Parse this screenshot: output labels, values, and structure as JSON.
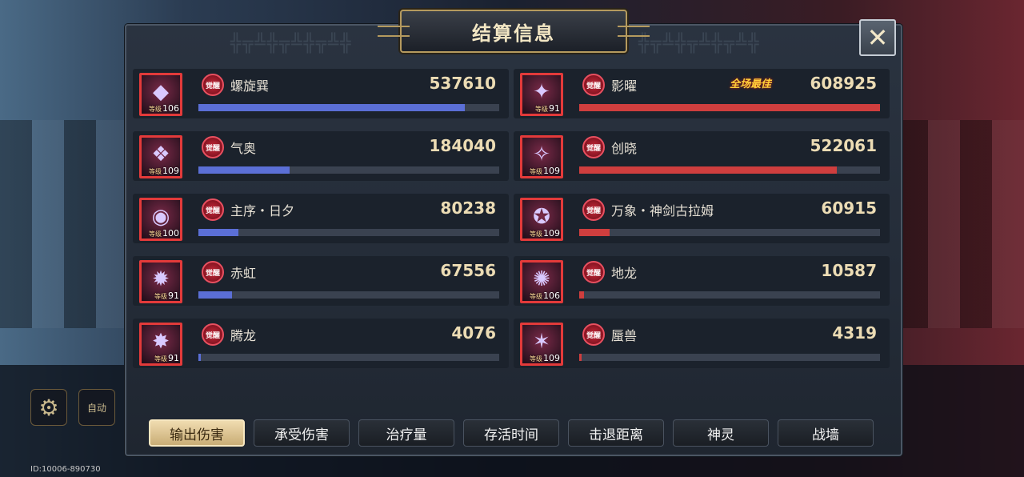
{
  "title": "结算信息",
  "uid": "ID:10006-890730",
  "side": {
    "auto_label": "自动"
  },
  "awaken_badge": "觉醒",
  "best_label": "全场最佳",
  "level_prefix": "等级",
  "left_team": [
    {
      "name": "螺旋巽",
      "level": "106",
      "damage": "537610",
      "fill": 0.885
    },
    {
      "name": "气奥",
      "level": "109",
      "damage": "184040",
      "fill": 0.303
    },
    {
      "name": "主序・日夕",
      "level": "100",
      "damage": "80238",
      "fill": 0.132
    },
    {
      "name": "赤虹",
      "level": "91",
      "damage": "67556",
      "fill": 0.111
    },
    {
      "name": "腾龙",
      "level": "91",
      "damage": "4076",
      "fill": 0.007
    }
  ],
  "right_team": [
    {
      "name": "影曜",
      "level": "91",
      "damage": "608925",
      "fill": 1.0,
      "best": true
    },
    {
      "name": "创晓",
      "level": "109",
      "damage": "522061",
      "fill": 0.857
    },
    {
      "name": "万象・神剑古拉姆",
      "level": "109",
      "damage": "60915",
      "fill": 0.1
    },
    {
      "name": "地龙",
      "level": "106",
      "damage": "10587",
      "fill": 0.017
    },
    {
      "name": "蜃兽",
      "level": "109",
      "damage": "4319",
      "fill": 0.007
    }
  ],
  "tabs": [
    {
      "label": "输出伤害",
      "active": true
    },
    {
      "label": "承受伤害",
      "active": false
    },
    {
      "label": "治疗量",
      "active": false
    },
    {
      "label": "存活时间",
      "active": false
    },
    {
      "label": "击退距离",
      "active": false
    },
    {
      "label": "神灵",
      "active": false
    },
    {
      "label": "战墙",
      "active": false
    }
  ],
  "colors": {
    "left_bar": "#5b6fd6",
    "right_bar": "#cf3e3e",
    "accent_gold": "#b59a5e"
  }
}
